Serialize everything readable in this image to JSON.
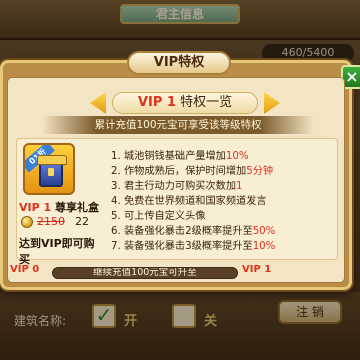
{
  "background": {
    "title": "君主信息",
    "capacity": "460/5400",
    "build_label": "建筑名称:",
    "check_open_label": "开",
    "check_close_label": "关",
    "cancel_button": "注 销"
  },
  "modal": {
    "title": "VIP特权",
    "close_label": "×",
    "level_label": "VIP 1",
    "level_suffix": "特权一览",
    "info_text": "累计充值100元宝可享受该等级特权",
    "gift": {
      "ribbon": "01折",
      "name_level": "VIP 1",
      "name_suffix": "尊享礼盒",
      "old_price": "2150",
      "new_price": "22",
      "note": "达到VIP即可购买"
    },
    "privileges": [
      {
        "prefix": "1. 城池铜钱基础产量增加",
        "highlight": "10",
        "suffix": "%"
      },
      {
        "prefix": "2. 作物成熟后，保护时间增加",
        "highlight": "5",
        "suffix": "分钟"
      },
      {
        "prefix": "3. 君主行动力可购买次数加",
        "highlight": "1",
        "suffix": ""
      },
      {
        "prefix": "4. 免费在世界频道和国家频道发言",
        "highlight": "",
        "suffix": ""
      },
      {
        "prefix": "5. 可上传自定义头像",
        "highlight": "",
        "suffix": ""
      },
      {
        "prefix": "6. 装备强化暴击2级概率提升至",
        "highlight": "50",
        "suffix": "%"
      },
      {
        "prefix": "7. 装备强化暴击3级概率提升至",
        "highlight": "10",
        "suffix": "%"
      }
    ],
    "progress": {
      "current_level": "VIP 0",
      "next_level": "VIP 1",
      "text": "继续充值100元宝可升至",
      "fraction": 0.0
    }
  }
}
